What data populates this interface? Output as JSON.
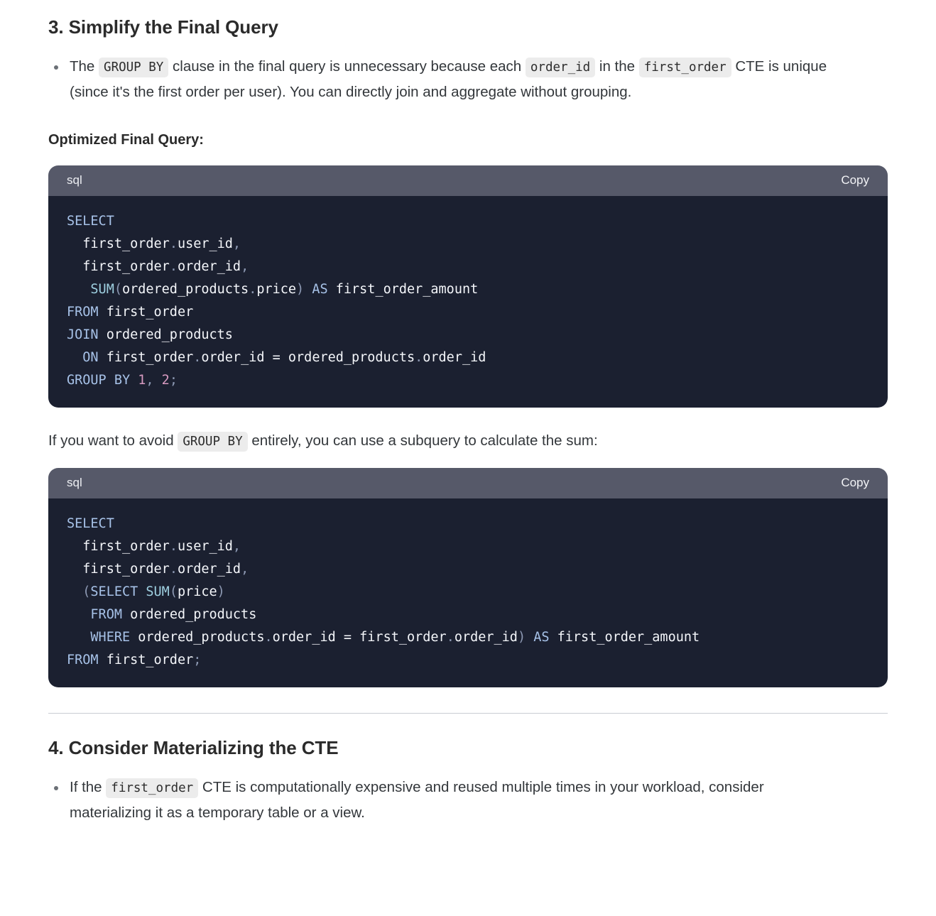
{
  "section3": {
    "heading": "3. Simplify the Final Query",
    "bullet": {
      "t1": "The ",
      "c1": "GROUP BY",
      "t2": " clause in the final query is unnecessary because each ",
      "c2": "order_id",
      "t3": " in the ",
      "c3": "first_order",
      "t4": " CTE is unique (since it's the first order per user). You can directly join and aggregate without grouping."
    },
    "subheading": "Optimized Final Query:",
    "code_block_1": {
      "language": "sql",
      "copy_label": "Copy",
      "lines": [
        "SELECT",
        "  first_order.user_id,",
        "  first_order.order_id,",
        "  SUM(ordered_products.price) AS first_order_amount",
        "FROM first_order",
        "JOIN ordered_products",
        "  ON first_order.order_id = ordered_products.order_id",
        "GROUP BY 1, 2;"
      ]
    },
    "mid_paragraph": {
      "t1": "If you want to avoid ",
      "c1": "GROUP BY",
      "t2": " entirely, you can use a subquery to calculate the sum:"
    },
    "code_block_2": {
      "language": "sql",
      "copy_label": "Copy",
      "lines": [
        "SELECT",
        "  first_order.user_id,",
        "  first_order.order_id,",
        "  (SELECT SUM(price)",
        "   FROM ordered_products",
        "   WHERE ordered_products.order_id = first_order.order_id) AS first_order_amount",
        "FROM first_order;"
      ]
    }
  },
  "section4": {
    "heading": "4. Consider Materializing the CTE",
    "bullet": {
      "t1": "If the ",
      "c1": "first_order",
      "t2": " CTE is computationally expensive and reused multiple times in your workload, consider materializing it as a temporary table or a view."
    }
  },
  "colors": {
    "code_header_bg": "#565969",
    "code_body_bg": "#1b2030",
    "keyword": "#a7c2e8",
    "function": "#9ecfe0",
    "number": "#d79ac0",
    "punctuation": "#8d99b3",
    "inline_chip_bg": "#ececec",
    "text": "#33373b"
  }
}
